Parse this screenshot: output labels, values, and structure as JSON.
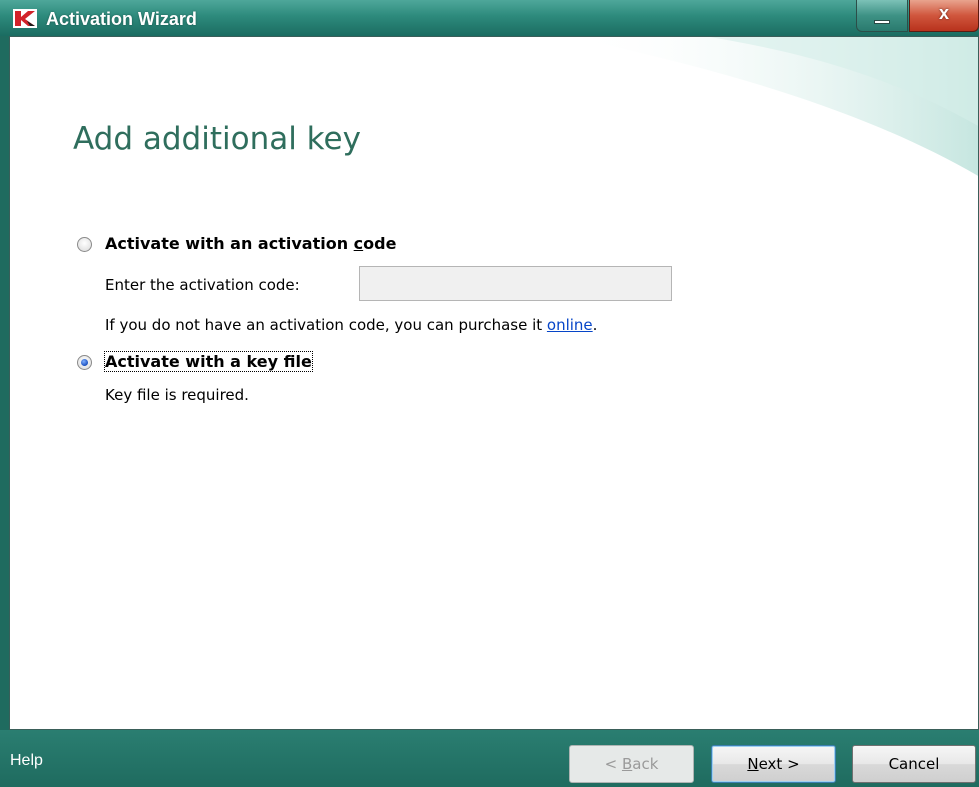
{
  "window": {
    "title": "Activation Wizard",
    "close_glyph": "x",
    "accent_color": "#1f6b5f",
    "heading_color": "#2f6e5d"
  },
  "page": {
    "heading": "Add additional key"
  },
  "option_code": {
    "label_prefix": "Activate with an activation ",
    "label_accel": "c",
    "label_suffix": "ode",
    "selected": false,
    "field_label": "Enter the activation code:",
    "field_value": "",
    "hint_text": "If you do not have an activation code, you can purchase it ",
    "hint_link": "online",
    "hint_end": "."
  },
  "option_keyfile": {
    "label": "Activate with a key file",
    "selected": true,
    "note": "Key file is required."
  },
  "footer": {
    "help": "Help",
    "back_prefix": "< ",
    "back_accel": "B",
    "back_suffix": "ack",
    "next_accel": "N",
    "next_suffix": "ext >",
    "cancel": "Cancel"
  }
}
